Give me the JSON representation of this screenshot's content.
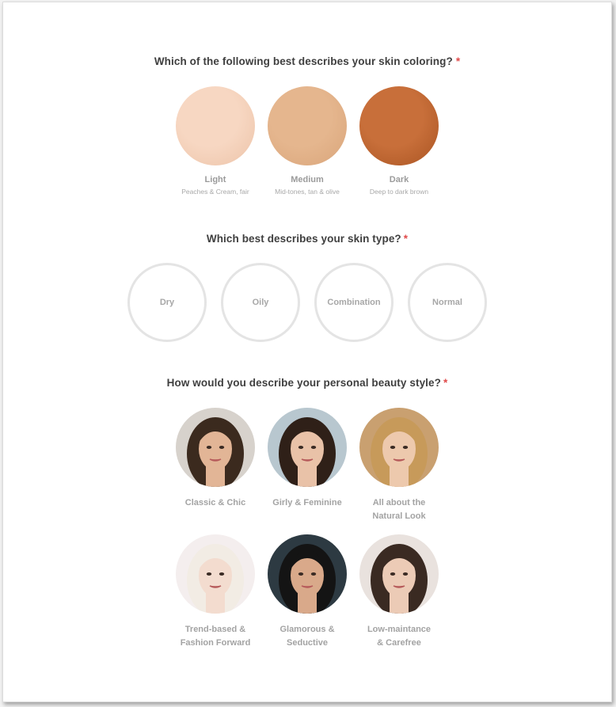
{
  "skin_coloring": {
    "question": "Which of the following best describes your skin coloring?",
    "required_mark": "*",
    "options": [
      {
        "label": "Light",
        "sub": "Peaches & Cream, fair",
        "color": "#f7d7c2",
        "shade": "#ecc3a8"
      },
      {
        "label": "Medium",
        "sub": "Mid-tones, tan & olive",
        "color": "#e5b68e",
        "shade": "#d9a57a"
      },
      {
        "label": "Dark",
        "sub": "Deep to dark brown",
        "color": "#c86f3a",
        "shade": "#a95422"
      }
    ]
  },
  "skin_type": {
    "question": "Which best describes your skin type?",
    "required_mark": "*",
    "options": [
      "Dry",
      "Oily",
      "Combination",
      "Normal"
    ]
  },
  "beauty_style": {
    "question": "How would you describe your personal beauty style?",
    "required_mark": "*",
    "options": [
      {
        "line1": "Classic & Chic",
        "line2": "",
        "hair": "#3b2a1e",
        "skin": "#e2b596",
        "bg": "#d7d2cc"
      },
      {
        "line1": "Girly & Feminine",
        "line2": "",
        "hair": "#2f2018",
        "skin": "#e9c2a8",
        "bg": "#b8c7cf"
      },
      {
        "line1": "All about the",
        "line2": "Natural Look",
        "hair": "#c79a5a",
        "skin": "#edc9ad",
        "bg": "#c9a070"
      },
      {
        "line1": "Trend-based &",
        "line2": "Fashion Forward",
        "hair": "#f2ece4",
        "skin": "#f3dccf",
        "bg": "#f4eeee"
      },
      {
        "line1": "Glamorous &",
        "line2": "Seductive",
        "hair": "#141414",
        "skin": "#d9a98a",
        "bg": "#2d3a42"
      },
      {
        "line1": "Low-maintance",
        "line2": "& Carefree",
        "hair": "#3a2a22",
        "skin": "#eccbb6",
        "bg": "#e9e2de"
      }
    ]
  },
  "colors": {
    "required": "#e04a4a",
    "question_text": "#3f3f3f",
    "muted_text": "#a3a3a3",
    "ring": "#e4e4e4"
  }
}
